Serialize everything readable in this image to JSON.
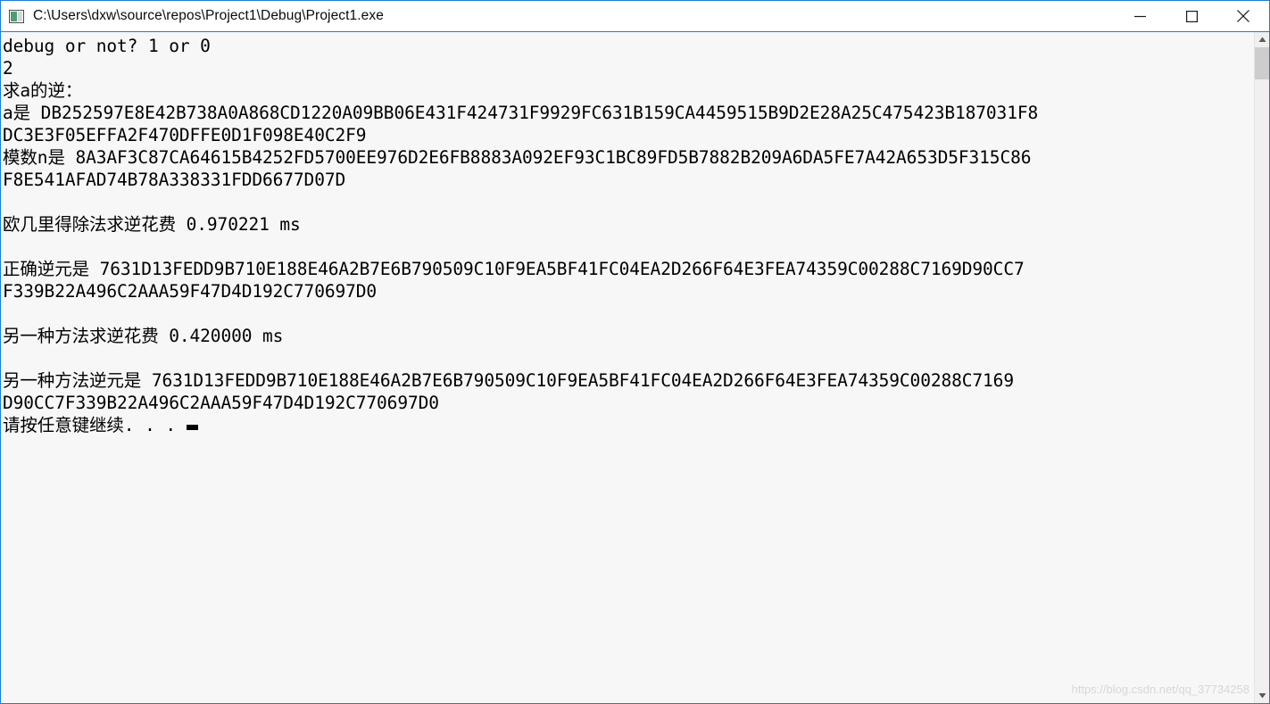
{
  "window": {
    "title": "C:\\Users\\dxw\\source\\repos\\Project1\\Debug\\Project1.exe",
    "app_icon": "console-app-icon",
    "controls": {
      "minimize": "minimize-button",
      "maximize": "maximize-button",
      "close": "close-button"
    },
    "accent_color": "#1a7fd4",
    "titlebar_background": "#ffffff",
    "console_background": "#f7f7f7",
    "console_foreground": "#000000"
  },
  "console": {
    "lines": [
      "debug or not? 1 or 0",
      "2",
      "求a的逆：",
      "a是 DB252597E8E42B738A0A868CD1220A09BB06E431F424731F9929FC631B159CA4459515B9D2E28A25C475423B187031F8",
      "DC3E3F05EFFA2F470DFFE0D1F098E40C2F9",
      "模数n是 8A3AF3C87CA64615B4252FD5700EE976D2E6FB8883A092EF93C1BC89FD5B7882B209A6DA5FE7A42A653D5F315C86",
      "F8E541AFAD74B78A338331FDD6677D07D",
      "",
      "欧几里得除法求逆花费 0.970221 ms",
      "",
      "正确逆元是 7631D13FEDD9B710E188E46A2B7E6B790509C10F9EA5BF41FC04EA2D266F64E3FEA74359C00288C7169D90CC7",
      "F339B22A496C2AAA59F47D4D192C770697D0",
      "",
      "另一种方法求逆花费 0.420000 ms",
      "",
      "另一种方法逆元是 7631D13FEDD9B710E188E46A2B7E6B790509C10F9EA5BF41FC04EA2D266F64E3FEA74359C00288C7169",
      "D90CC7F339B22A496C2AAA59F47D4D192C770697D0",
      "请按任意键继续. . ."
    ],
    "prompt_caret": "block-cursor"
  },
  "scrollbar": {
    "up_arrow": "scroll-up-arrow-icon",
    "down_arrow": "scroll-down-arrow-icon",
    "thumb": "scrollbar-thumb"
  },
  "watermark": "https://blog.csdn.net/qq_37734258"
}
